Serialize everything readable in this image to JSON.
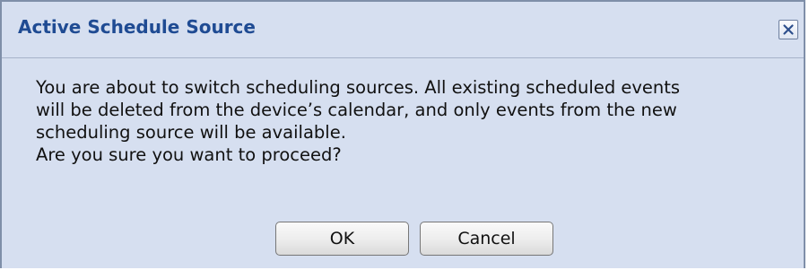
{
  "dialog": {
    "title": "Active Schedule Source",
    "close_icon": "close-icon",
    "message_lines": [
      "You are about to switch scheduling sources. All existing scheduled events",
      "will be deleted from the device’s calendar, and only events from the new",
      "scheduling source will be available.",
      "Are you sure you want to proceed?"
    ],
    "ok_label": "OK",
    "cancel_label": "Cancel"
  },
  "colors": {
    "background": "#d6dff0",
    "title": "#1f4b93",
    "border": "#7f8fa9"
  }
}
